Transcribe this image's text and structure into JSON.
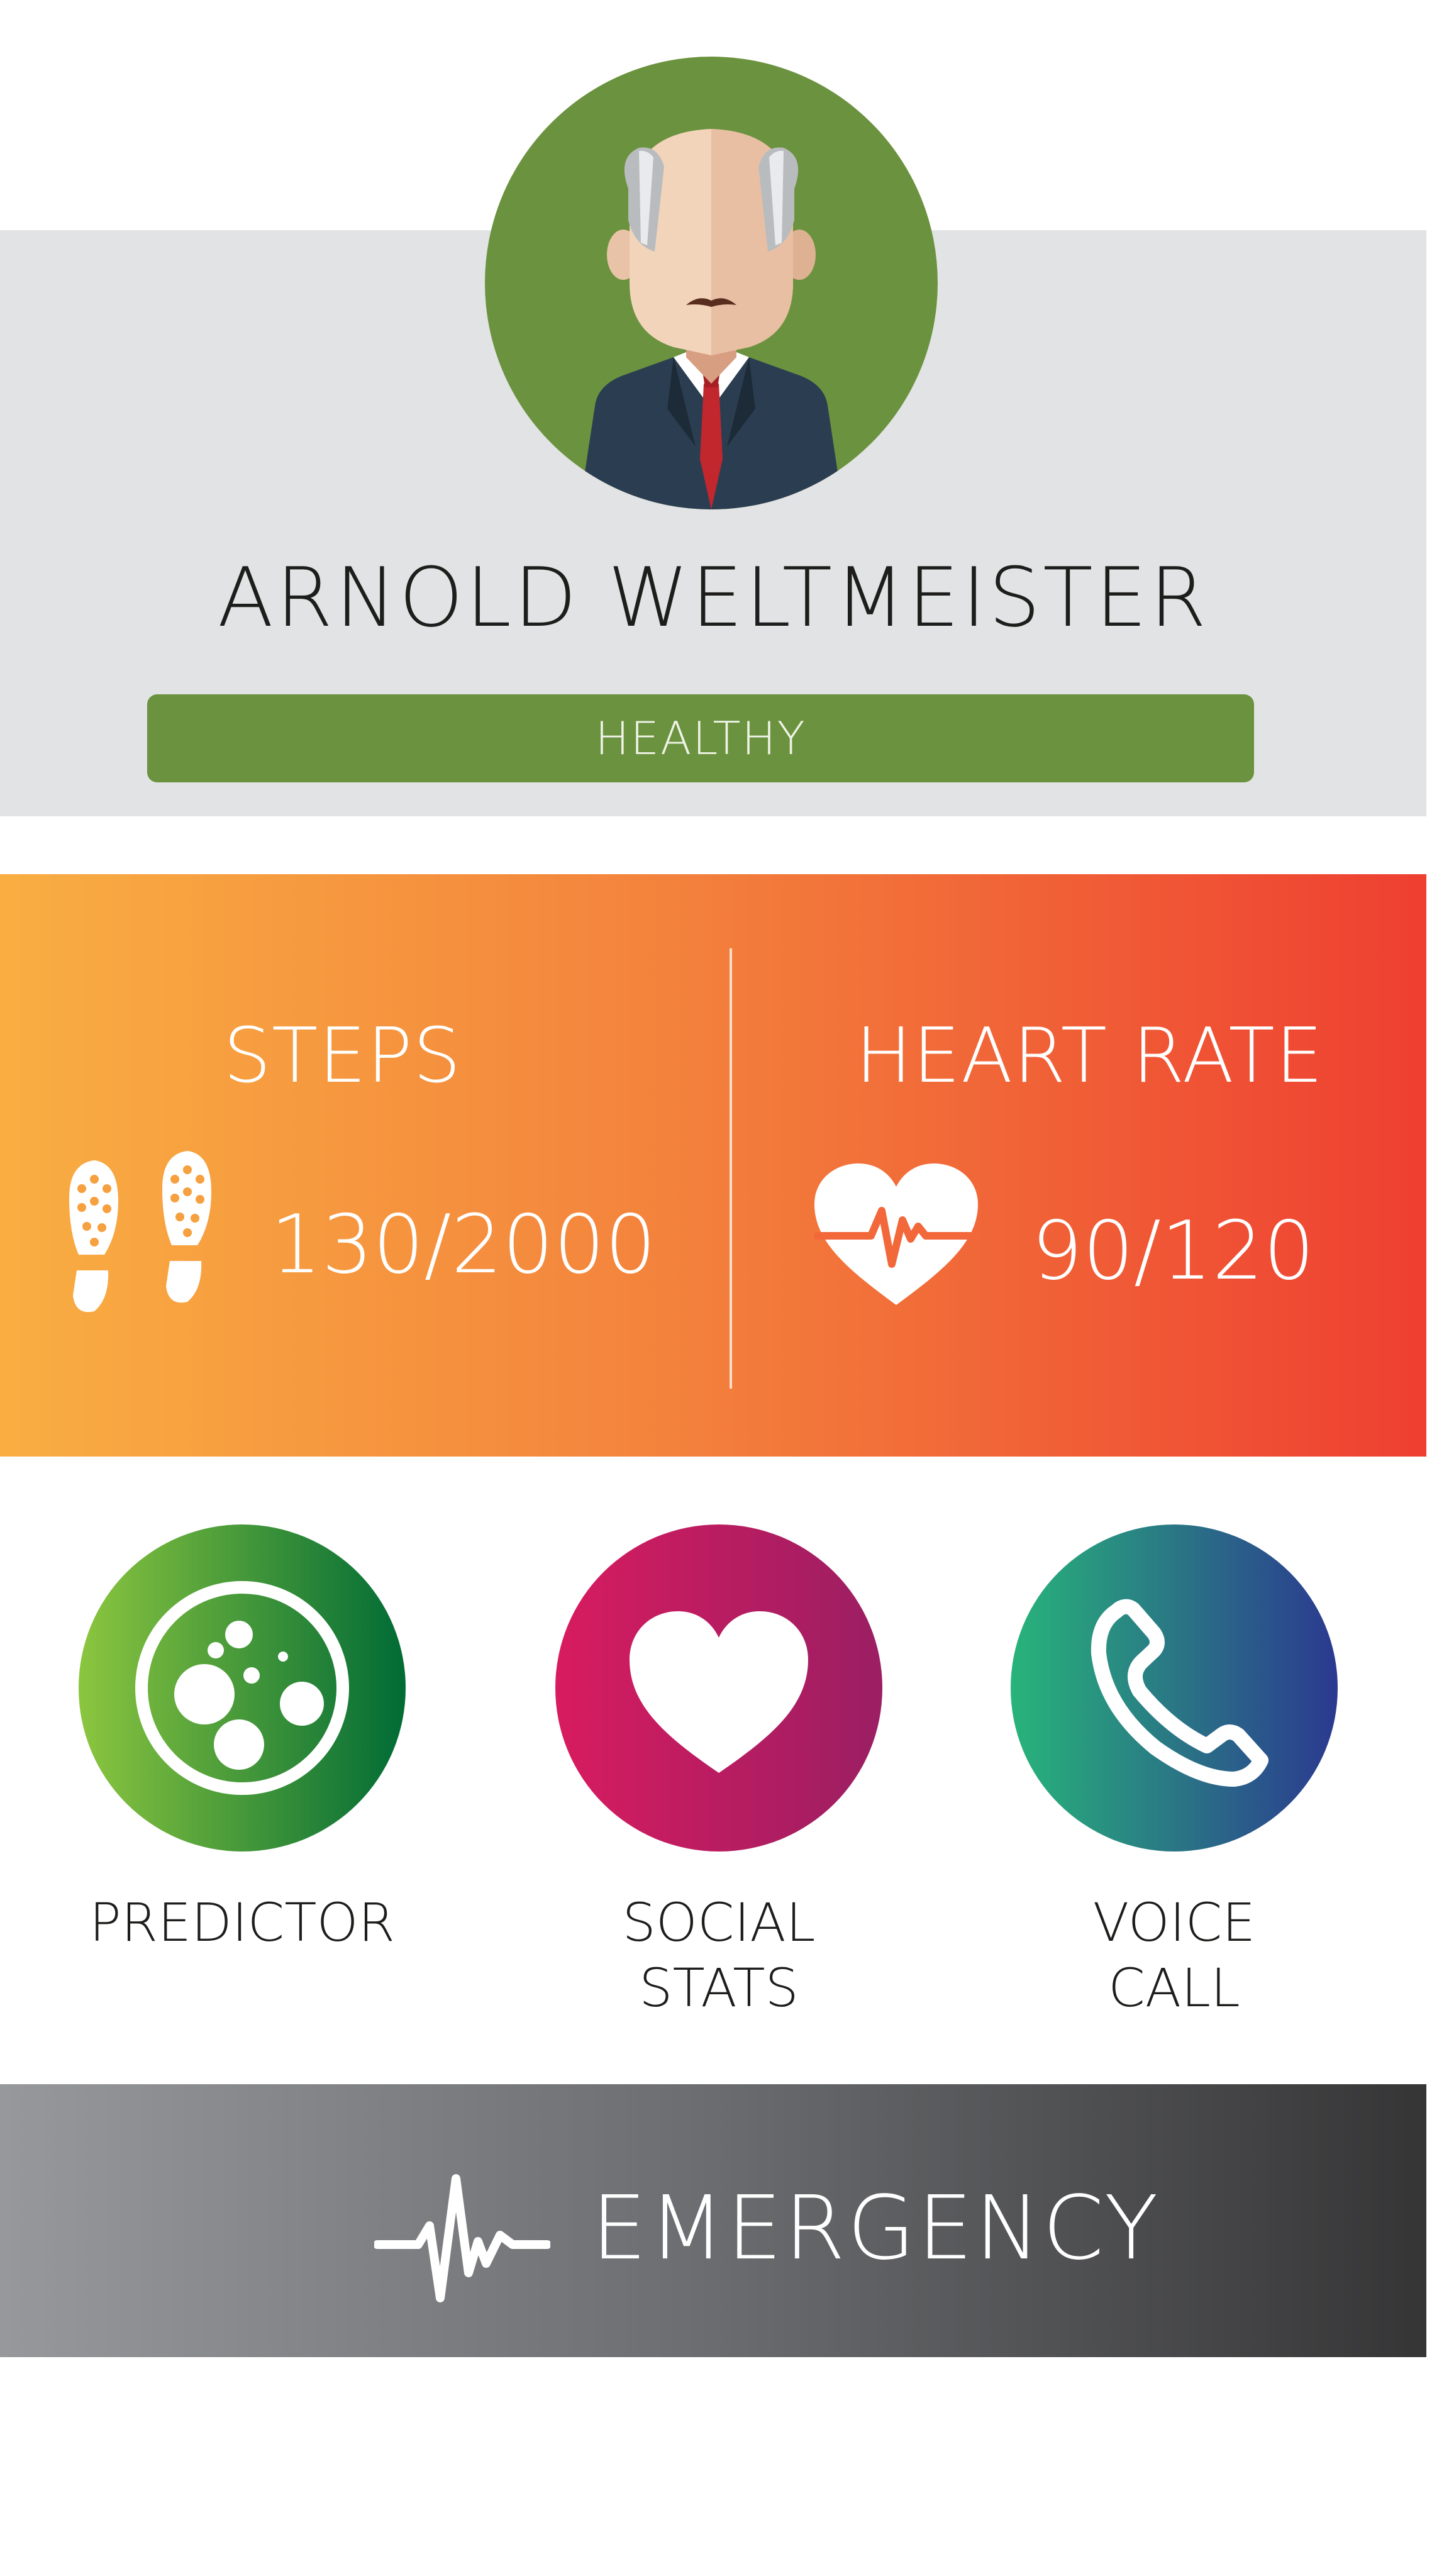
{
  "profile": {
    "name": "ARNOLD WELTMEISTER",
    "status": "HEALTHY",
    "avatar_icon": "elderly-man-avatar-icon"
  },
  "vitals": {
    "steps": {
      "title": "STEPS",
      "value": "130/2000",
      "icon": "footprints-icon"
    },
    "heart_rate": {
      "title": "HEART RATE",
      "value": "90/120",
      "icon": "heart-pulse-icon"
    }
  },
  "actions": [
    {
      "label": "PREDICTOR",
      "icon": "cells-icon",
      "color_start": "#8cc63f",
      "color_end": "#006b35"
    },
    {
      "label_line1": "SOCIAL",
      "label_line2": "STATS",
      "icon": "heart-icon",
      "color_start": "#d81b5f",
      "color_end": "#9b1e63"
    },
    {
      "label_line1": "VOICE",
      "label_line2": "CALL",
      "icon": "phone-icon",
      "color_start": "#28b47a",
      "color_end": "#2b3990"
    }
  ],
  "emergency": {
    "label": "EMERGENCY",
    "icon": "pulse-line-icon"
  },
  "colors": {
    "profile_band": "#e2e3e4",
    "accent_green": "#6b923e",
    "vitals_gradient_start": "#f9ae42",
    "vitals_gradient_end": "#ee3f31",
    "emergency_gradient_start": "#97989b",
    "emergency_gradient_end": "#353536"
  }
}
